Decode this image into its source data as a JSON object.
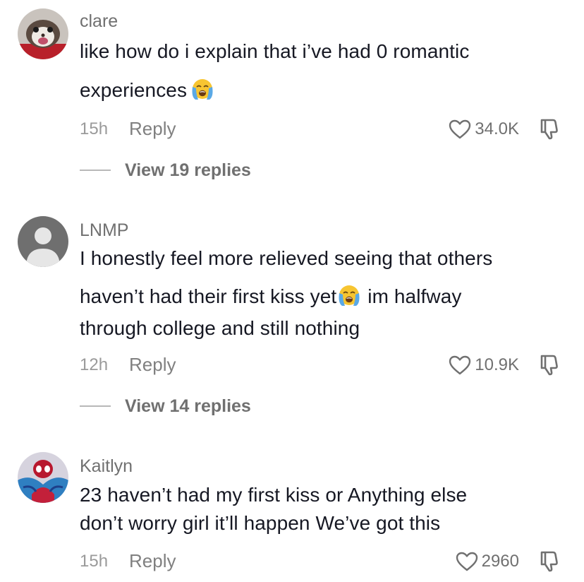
{
  "comments": [
    {
      "username": "clare",
      "text_line1": "like how do i explain that i’ve had 0 romantic",
      "text_line2": "experiences",
      "time": "15h",
      "reply_label": "Reply",
      "likes": "34.0K",
      "view_replies": "View 19 replies",
      "avatar_icon": "ferret-avatar-icon"
    },
    {
      "username": "LNMP",
      "text_line1": "I honestly feel more relieved seeing that others",
      "text_line2a": "haven’t had their first kiss yet",
      "text_line2b": "im halfway",
      "text_line3": "through college and still nothing",
      "time": "12h",
      "reply_label": "Reply",
      "likes": "10.9K",
      "view_replies": "View 14 replies",
      "avatar_icon": "default-user-avatar-icon"
    },
    {
      "username": "Kaitlyn",
      "text_line1": "23 haven’t had my first kiss or Anything else",
      "text_line2": "don’t worry girl it’ll happen We’ve got this",
      "time": "15h",
      "reply_label": "Reply",
      "likes": "2960",
      "avatar_icon": "spiderman-avatar-icon"
    }
  ],
  "icons": {
    "like": "heart-outline-icon",
    "dislike": "thumbs-down-icon",
    "emoji": "loudly-crying-face-emoji"
  },
  "colors": {
    "username": "#707070",
    "body": "#161823",
    "meta": "#9a9a9a",
    "emoji_face": "#f7c531",
    "emoji_tears": "#5aa9e6"
  }
}
